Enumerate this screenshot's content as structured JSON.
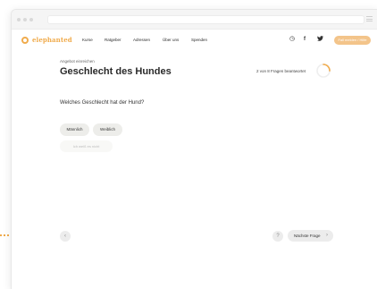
{
  "nav": {
    "logo_text": "elephanted",
    "links": [
      "Kurse",
      "Ratgeber",
      "Adressen",
      "Über uns",
      "Spenden"
    ],
    "icons": [
      "clock-icon",
      "facebook-icon",
      "twitter-icon"
    ],
    "icon_glyphs": [
      "◷",
      "f",
      "🐦"
    ],
    "cta_label": "Fall melden / Hilfe"
  },
  "main": {
    "subtitle": "Angebot einreichen",
    "title": "Geschlecht des Hundes",
    "progress_text": "2 von 8 Fragen beantwortet",
    "progress_fraction": 0.25,
    "question": "Welches Geschlecht hat der Hund?",
    "options": [
      "Männlich",
      "Weiblich"
    ],
    "ghost_option": "Ich weiß es nicht"
  },
  "footer": {
    "back_glyph": "‹",
    "info_glyph": "?",
    "next_label": "Nächste Frage",
    "next_glyph": "›"
  },
  "colors": {
    "accent": "#f0ab4c",
    "cta_bg": "#f3c48a",
    "pill_bg": "#ededea"
  }
}
